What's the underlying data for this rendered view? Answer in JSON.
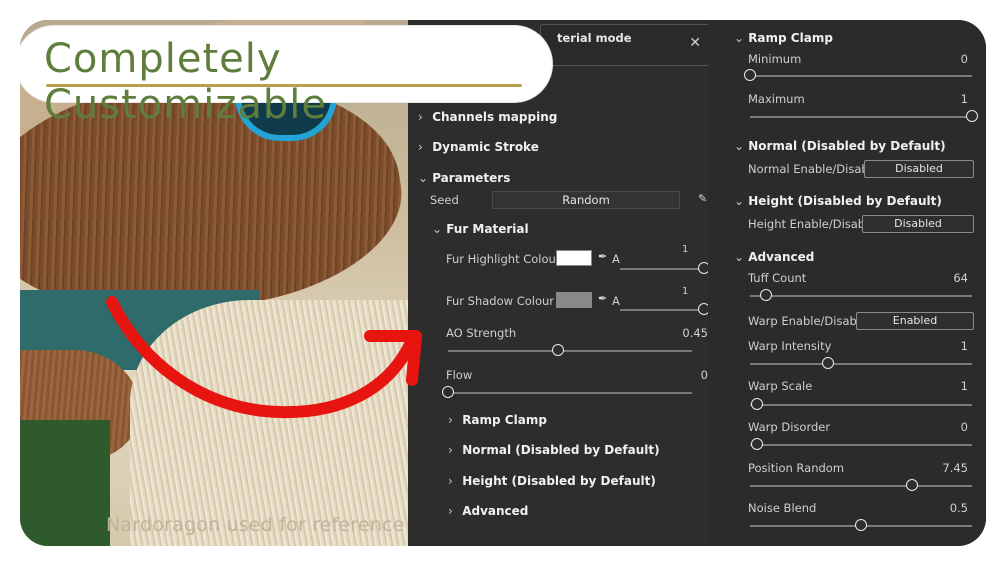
{
  "title": "Completely Customizable",
  "credit": "Nardoragon used for reference",
  "left_panel": {
    "mode_label": "terial mode",
    "close_icon": "close-icon",
    "sections": {
      "channels": "Channels mapping",
      "dynamic": "Dynamic Stroke",
      "parameters": "Parameters",
      "fur_material": "Fur Material",
      "ramp": "Ramp Clamp",
      "normal": "Normal (Disabled by Default)",
      "height": "Height (Disabled by Default)",
      "advanced": "Advanced"
    },
    "seed_label": "Seed",
    "seed_value": "Random",
    "highlight_label": "Fur Highlight Colour",
    "highlight_a": "A",
    "highlight_val": "1",
    "highlight_level": 1,
    "shadow_label": "Fur Shadow Colour",
    "shadow_a": "A",
    "shadow_val": "1",
    "shadow_level": 1,
    "ao_label": "AO Strength",
    "ao_val": "0.45",
    "ao_level": 0.45,
    "flow_label": "Flow",
    "flow_val": "0",
    "flow_level": 0,
    "colors": {
      "highlight": "#ffffff",
      "shadow": "#8a8a8a"
    }
  },
  "right_panel": {
    "ramp": "Ramp Clamp",
    "minimum_label": "Minimum",
    "minimum_val": "0",
    "minimum_level": 0,
    "maximum_label": "Maximum",
    "maximum_val": "1",
    "maximum_level": 1,
    "normal": "Normal (Disabled by Default)",
    "normal_label": "Normal Enable/Disable",
    "normal_btn": "Disabled",
    "height": "Height (Disabled by Default)",
    "height_label": "Height Enable/Disable",
    "height_btn": "Disabled",
    "advanced": "Advanced",
    "tuff_label": "Tuff Count",
    "tuff_val": "64",
    "tuff_level": 0.07,
    "warp_label": "Warp Enable/Disable",
    "warp_btn": "Enabled",
    "wi_label": "Warp Intensity",
    "wi_val": "1",
    "wi_level": 0.35,
    "ws_label": "Warp Scale",
    "ws_val": "1",
    "ws_level": 0.03,
    "wd_label": "Warp Disorder",
    "wd_val": "0",
    "wd_level": 0.03,
    "pr_label": "Position Random",
    "pr_val": "7.45",
    "pr_level": 0.73,
    "nb_label": "Noise Blend",
    "nb_val": "0.5",
    "nb_level": 0.5
  }
}
